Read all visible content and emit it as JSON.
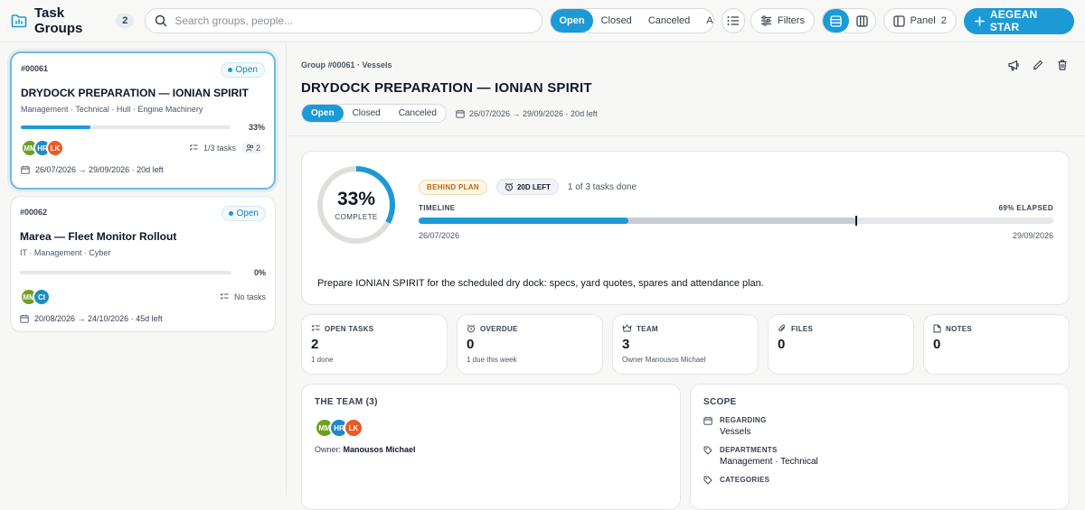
{
  "header": {
    "title": "Task Groups",
    "count": "2",
    "search_placeholder": "Search groups, people...",
    "status_filters": [
      {
        "label": "Open",
        "active": true
      },
      {
        "label": "Closed",
        "active": false
      },
      {
        "label": "Canceled",
        "active": false
      },
      {
        "label": "All",
        "active": false
      }
    ],
    "filters_label": "Filters",
    "panel_label": "Panel",
    "panel_count": "2",
    "primary_label": "AEGEAN STAR"
  },
  "groups": [
    {
      "id": "#00061",
      "status": "Open",
      "title": "DRYDOCK PREPARATION — IONIAN SPIRIT",
      "tags": "Management · Technical · Hull · Engine Machinery",
      "progress": 33,
      "progress_label": "33%",
      "avatars": [
        "MM",
        "HR",
        "LK"
      ],
      "tasks_label": "1/3 tasks",
      "people_count": "2",
      "dates": "26/07/2026 → 29/09/2026 · 20d left"
    },
    {
      "id": "#00062",
      "status": "Open",
      "title": "Marea — Fleet Monitor Rollout",
      "tags": "IT · Management · Cyber",
      "progress": 0,
      "progress_label": "0%",
      "avatars": [
        "MM",
        "CI"
      ],
      "tasks_label": "No tasks",
      "dates": "20/08/2026 → 24/10/2026 · 45d left"
    }
  ],
  "detail": {
    "breadcrumb": "Group #00061 · Vessels",
    "title": "DRYDOCK PREPARATION — IONIAN SPIRIT",
    "status_tabs": [
      {
        "label": "Open",
        "active": true
      },
      {
        "label": "Closed",
        "active": false
      },
      {
        "label": "Canceled",
        "active": false
      }
    ],
    "dates": "26/07/2026 → 29/09/2026 · 20d left",
    "completion": 33,
    "completion_label": "33%",
    "complete_text": "COMPLETE",
    "behind_badge": "BEHIND PLAN",
    "days_left_badge": "20D LEFT",
    "tasks_done": "1 of 3 tasks done",
    "timeline_label": "TIMELINE",
    "elapsed": 69,
    "elapsed_label": "69% ELAPSED",
    "start_date": "26/07/2026",
    "end_date": "29/09/2026",
    "description": "Prepare IONIAN SPIRIT for the scheduled dry dock: specs, yard quotes, spares and attendance plan.",
    "stats": [
      {
        "label": "OPEN TASKS",
        "value": "2",
        "sub": "1 done",
        "icon": "list-check-icon"
      },
      {
        "label": "OVERDUE",
        "value": "0",
        "sub": "1 due this week",
        "icon": "alarm-clock-icon"
      },
      {
        "label": "TEAM",
        "value": "3",
        "sub": "Owner Manousos Michael",
        "icon": "team-icon"
      },
      {
        "label": "FILES",
        "value": "0",
        "sub": "",
        "icon": "paperclip-icon"
      },
      {
        "label": "NOTES",
        "value": "0",
        "sub": "",
        "icon": "note-icon"
      }
    ],
    "team": {
      "title": "THE TEAM (3)",
      "avatars": [
        "MM",
        "HR",
        "LK"
      ],
      "owner_prefix": "Owner:",
      "owner_name": "Manousos Michael"
    },
    "scope": {
      "title": "SCOPE",
      "items": [
        {
          "label": "REGARDING",
          "value": "Vessels",
          "icon": "calendar-icon"
        },
        {
          "label": "DEPARTMENTS",
          "value": "Management · Technical",
          "icon": "tag-icon"
        },
        {
          "label": "CATEGORIES",
          "value": "",
          "icon": "tag-icon"
        }
      ]
    }
  },
  "colors": {
    "accent": "#1b9ad6",
    "warning": "#b86b08",
    "avatar_green": "#6aa121",
    "avatar_blue": "#1e88c8",
    "avatar_orange": "#ea5a25"
  }
}
